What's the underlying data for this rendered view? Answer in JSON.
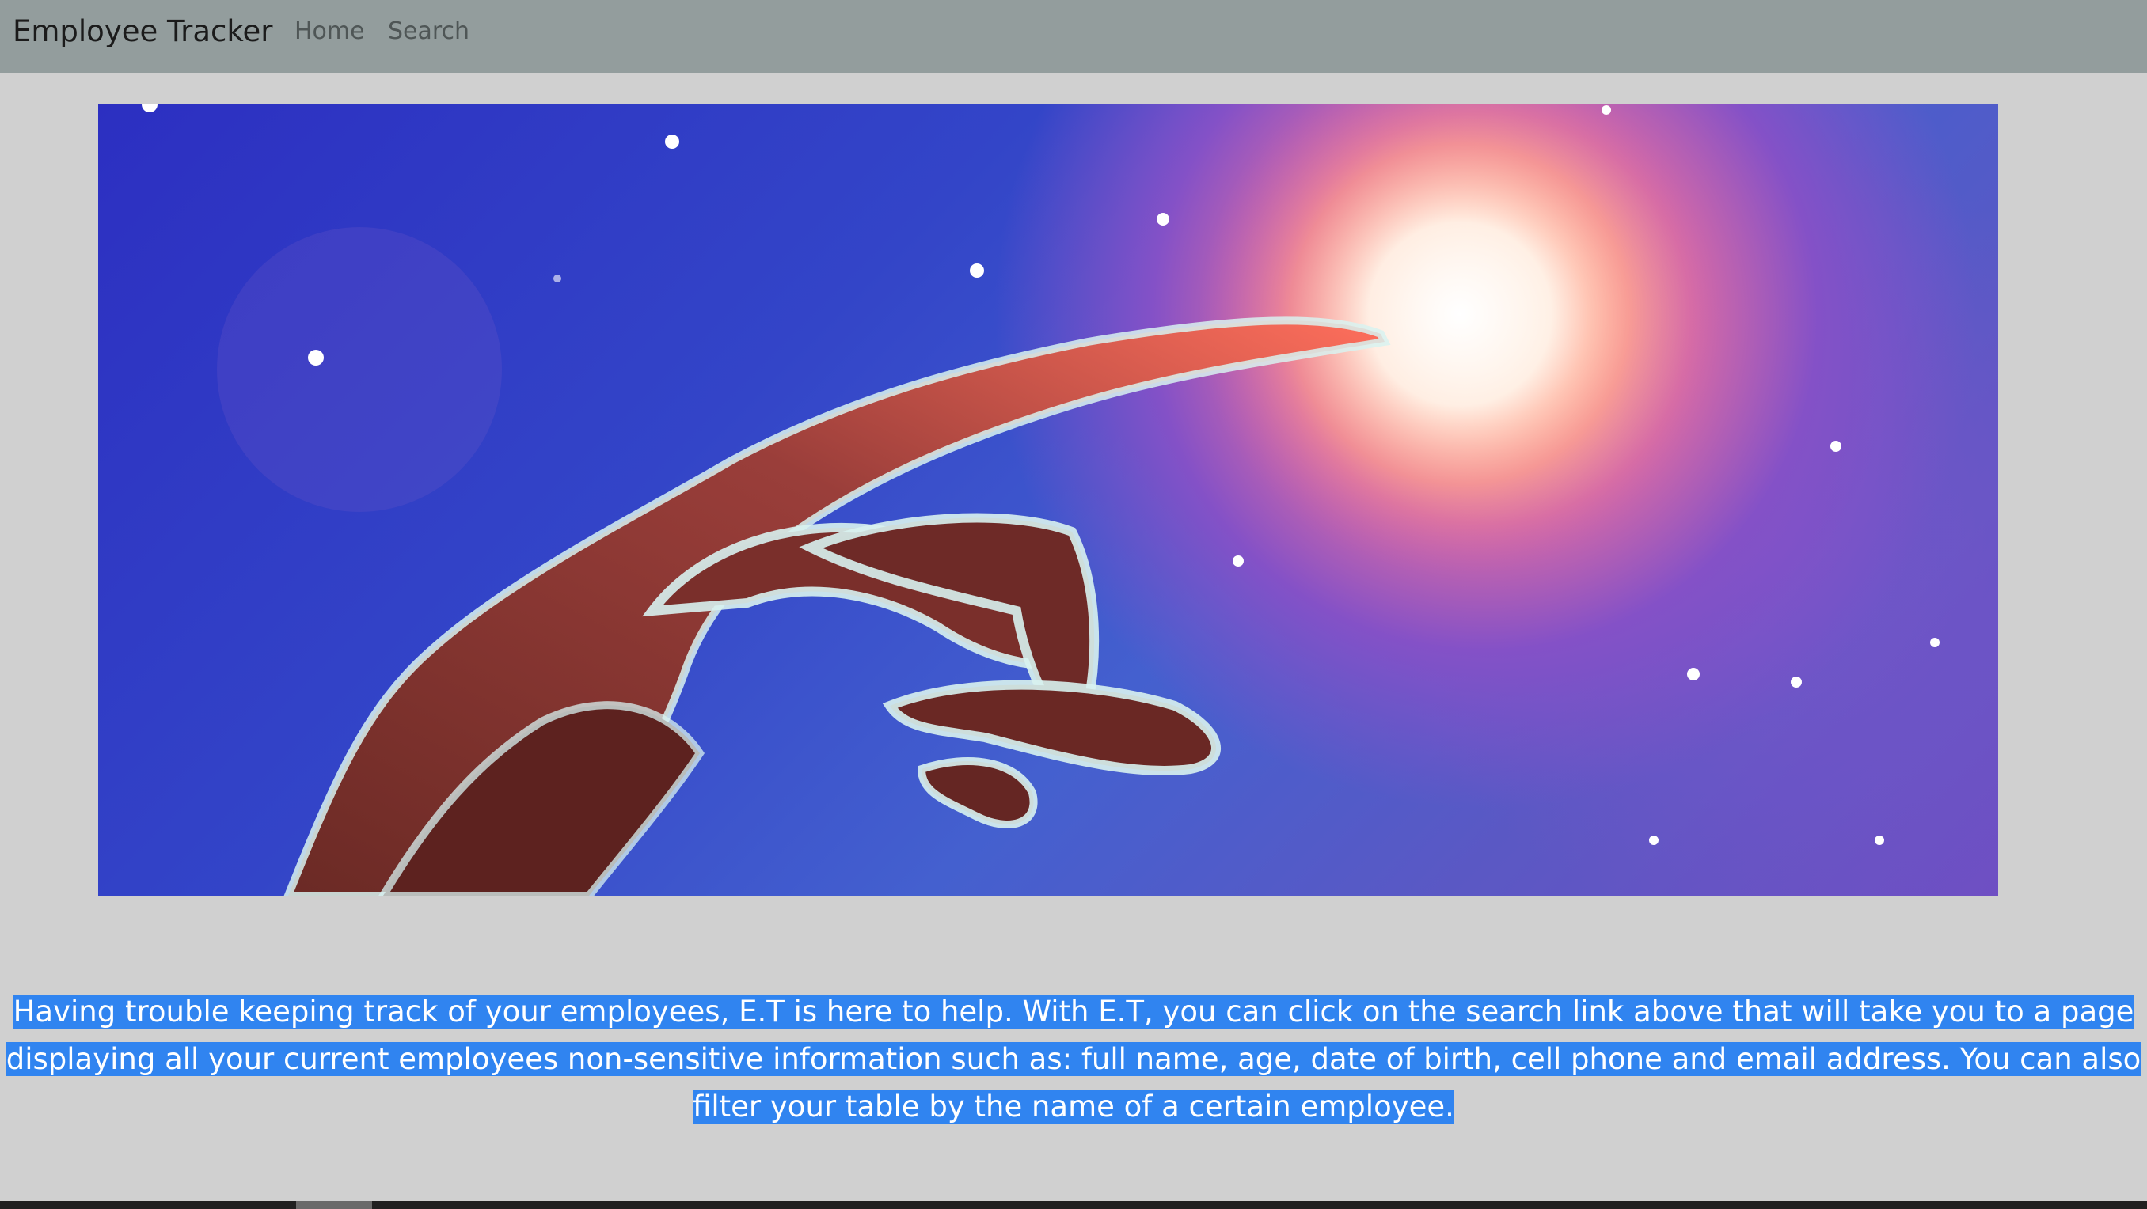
{
  "navbar": {
    "brand": "Employee Tracker",
    "links": [
      "Home",
      "Search"
    ]
  },
  "hero": {
    "image_description_icon": "hand-reaching-glowing-finger-image"
  },
  "main": {
    "description": "Having trouble keeping track of your employees, E.T is here to help. With E.T, you can click on the search link above that will take you to a page displaying all your current employees non-sensitive information such as: full name, age, date of birth, cell phone and email address. You can also filter your table by the name of a certain employee."
  },
  "colors": {
    "navbar_bg": "#939d9d",
    "page_bg": "#d0d0d0",
    "selection_highlight": "#3084f0"
  }
}
